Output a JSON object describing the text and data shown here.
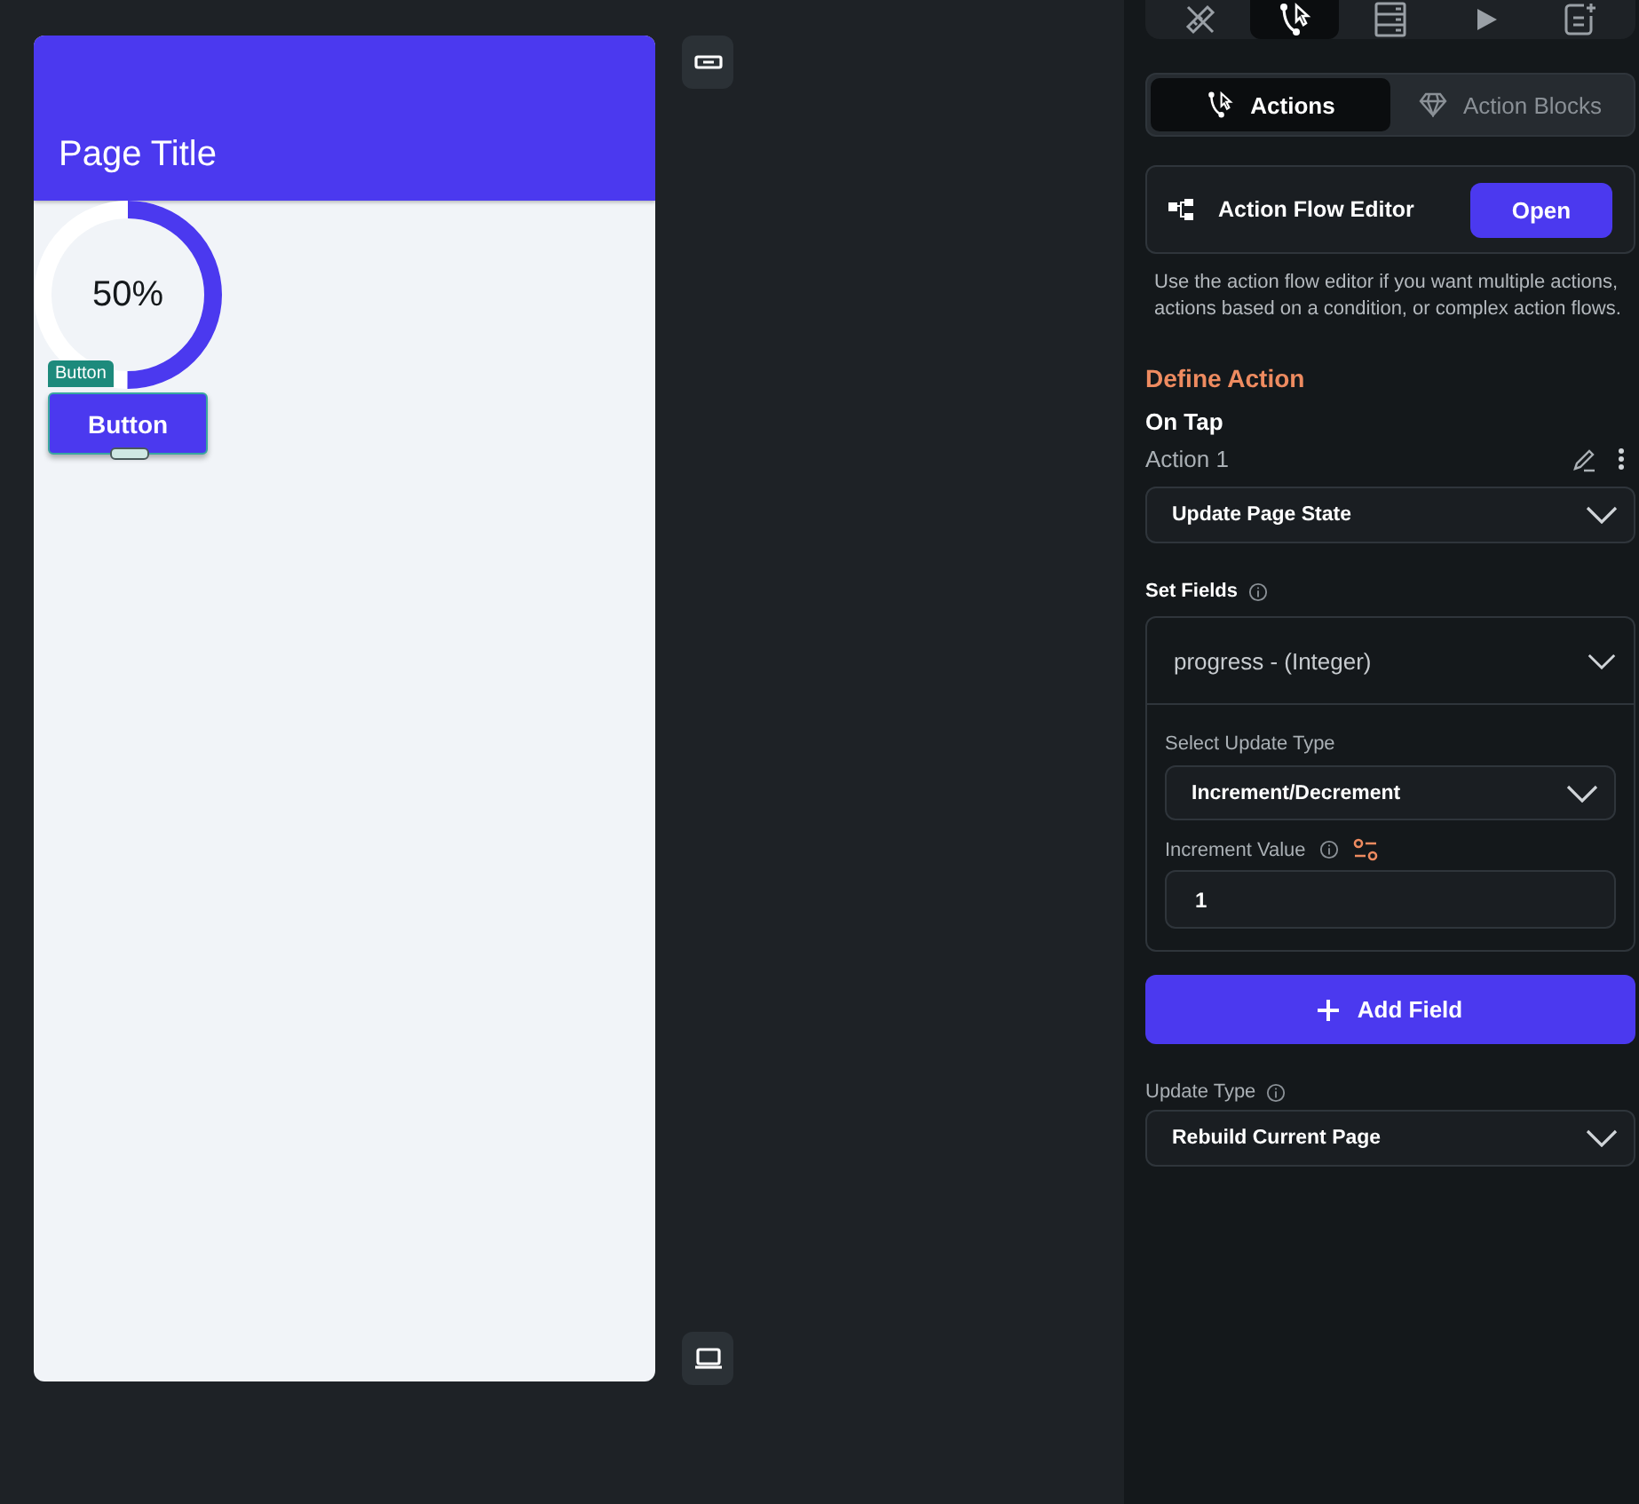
{
  "canvas": {
    "app_bar_title": "Page Title",
    "progress": {
      "level": 0.5,
      "label": "50%"
    },
    "selection_tag": "Button",
    "button": "Button"
  },
  "toolbar": [
    {
      "selected": false
    },
    {
      "selected": true
    },
    {
      "selected": false
    },
    {
      "selected": false
    },
    {
      "selected": false
    }
  ],
  "tabs": [
    {
      "label": "Actions",
      "selected": true
    },
    {
      "label": "Action Blocks",
      "selected": false
    }
  ],
  "action_flow_editor": {
    "title": "Action Flow Editor",
    "button": "Open",
    "description": "Use the action flow editor if you want multiple actions, actions based on a condition, or complex action flows."
  },
  "define_action": {
    "heading": "Define Action",
    "trigger": "On Tap",
    "action_label": "Action 1",
    "action_type": "Update Page State"
  },
  "set_fields": {
    "label": "Set Fields",
    "field": "progress - (Integer)",
    "expanded": true,
    "update_type_label": "Select Update Type",
    "update_type": "Increment/Decrement",
    "value_label": "Increment Value",
    "value": "1"
  },
  "add_field_button": "Add Field",
  "update_type": {
    "label": "Update Type",
    "value": "Rebuild Current Page"
  }
}
